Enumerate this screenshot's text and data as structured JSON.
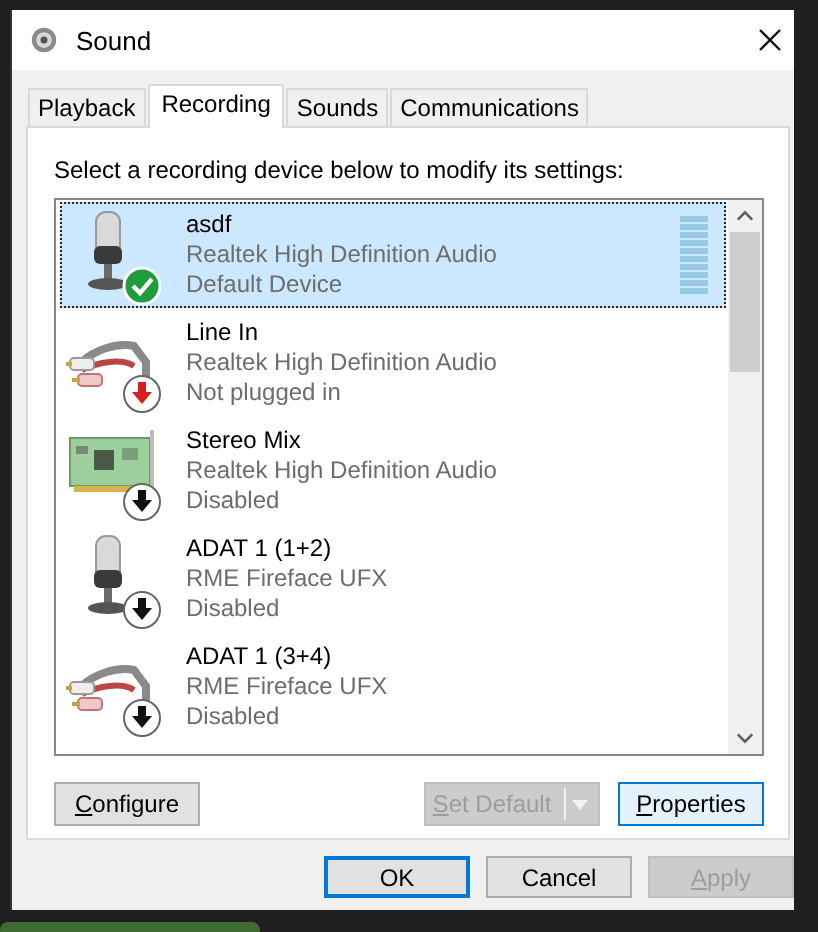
{
  "window": {
    "title": "Sound"
  },
  "tabs": [
    {
      "label": "Playback",
      "selected": false
    },
    {
      "label": "Recording",
      "selected": true
    },
    {
      "label": "Sounds",
      "selected": false
    },
    {
      "label": "Communications",
      "selected": false
    }
  ],
  "instruction": "Select a recording device below to modify its settings:",
  "devices": [
    {
      "kind": "microphone",
      "name": "asdf",
      "driver": "Realtek High Definition Audio",
      "status_text": "Default Device",
      "is_default": true,
      "unplugged": false,
      "disabled": false,
      "selected": true
    },
    {
      "kind": "line-in",
      "name": "Line In",
      "driver": "Realtek High Definition Audio",
      "status_text": "Not plugged in",
      "is_default": false,
      "unplugged": true,
      "disabled": false,
      "selected": false
    },
    {
      "kind": "card",
      "name": "Stereo Mix",
      "driver": "Realtek High Definition Audio",
      "status_text": "Disabled",
      "is_default": false,
      "unplugged": false,
      "disabled": true,
      "selected": false
    },
    {
      "kind": "microphone",
      "name": "ADAT 1 (1+2)",
      "driver": "RME Fireface UFX",
      "status_text": "Disabled",
      "is_default": false,
      "unplugged": false,
      "disabled": true,
      "selected": false
    },
    {
      "kind": "line-in",
      "name": "ADAT 1 (3+4)",
      "driver": "RME Fireface UFX",
      "status_text": "Disabled",
      "is_default": false,
      "unplugged": false,
      "disabled": true,
      "selected": false
    }
  ],
  "panel_buttons": [
    {
      "kind": "button",
      "label": "**C**onfigure",
      "disabled": false
    },
    {
      "kind": "split",
      "label": "**S**et Default",
      "disabled": true
    },
    {
      "kind": "button",
      "label": "**P**roperties",
      "disabled": false,
      "focused": true
    }
  ],
  "dialog_buttons": [
    {
      "label": "OK",
      "disabled": false,
      "default": true
    },
    {
      "label": "Cancel",
      "disabled": false,
      "default": false
    },
    {
      "label": "**A**pply",
      "disabled": true,
      "default": false
    }
  ]
}
